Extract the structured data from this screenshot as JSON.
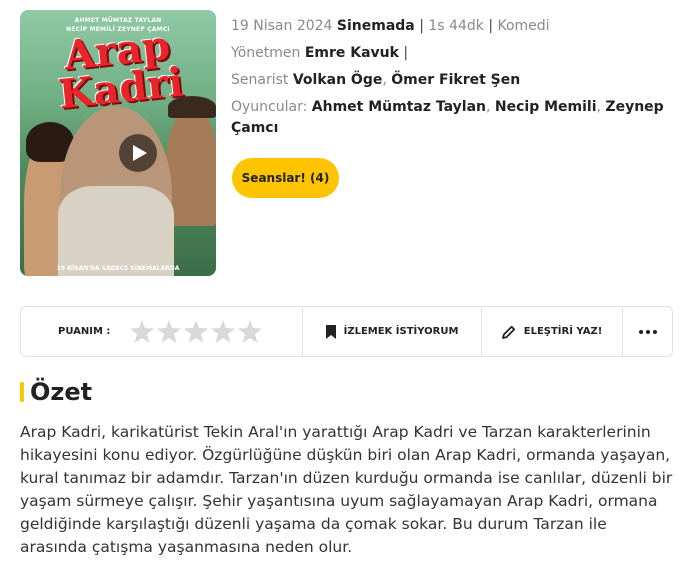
{
  "poster": {
    "credits_top": "AHMET MÜMTAZ TAYLAN\nNECİP MEMİLİ   ZEYNEP ÇAMCI",
    "title_art": "Arap Kadri",
    "tagline": "19 NİSAN'DA SADECE SİNEMALARDA",
    "play_icon": "play-icon"
  },
  "meta": {
    "date": "19 Nisan 2024",
    "release_status": "Sinemada",
    "sep": "|",
    "duration": "1s 44dk",
    "genre": "Komedi",
    "director_label": "Yönetmen",
    "director": "Emre Kavuk",
    "writer_label": "Senarist",
    "writers": [
      "Volkan Öge",
      "Ömer Fikret Şen"
    ],
    "cast_label": "Oyuncular:",
    "cast": [
      "Ahmet Mümtaz Taylan",
      "Necip Memili",
      "Zeynep Çamcı"
    ],
    "comma": ","
  },
  "seans_button": "Seanslar! (4)",
  "action_bar": {
    "rating_label": "PUANIM :",
    "stars": 5,
    "rating_value": 0,
    "watchlist_label": "İZLEMEK İSTİYORUM",
    "review_label": "ELEŞTİRİ YAZ!",
    "more_icon": "more-dots-icon"
  },
  "section": {
    "title": "Özet",
    "summary": "Arap Kadri, karikatürist Tekin Aral'ın yarattığı Arap Kadri ve Tarzan karakterlerinin hikayesini konu ediyor. Özgürlüğüne düşkün biri olan Arap Kadri, ormanda yaşayan, kural tanımaz bir adamdır. Tarzan'ın düzen kurduğu ormanda ise canlılar, düzenli bir yaşam sürmeye çalışır. Şehir yaşantısına uyum sağlayamayan Arap Kadri, ormana geldiğinde karşılaştığı düzenli yaşama da çomak sokar. Bu durum Tarzan ile arasında çatışma yaşanmasına neden olur."
  },
  "colors": {
    "accent": "#ffc400",
    "text": "#222222",
    "muted": "#8a8a8a",
    "star": "#d9d9d9"
  }
}
